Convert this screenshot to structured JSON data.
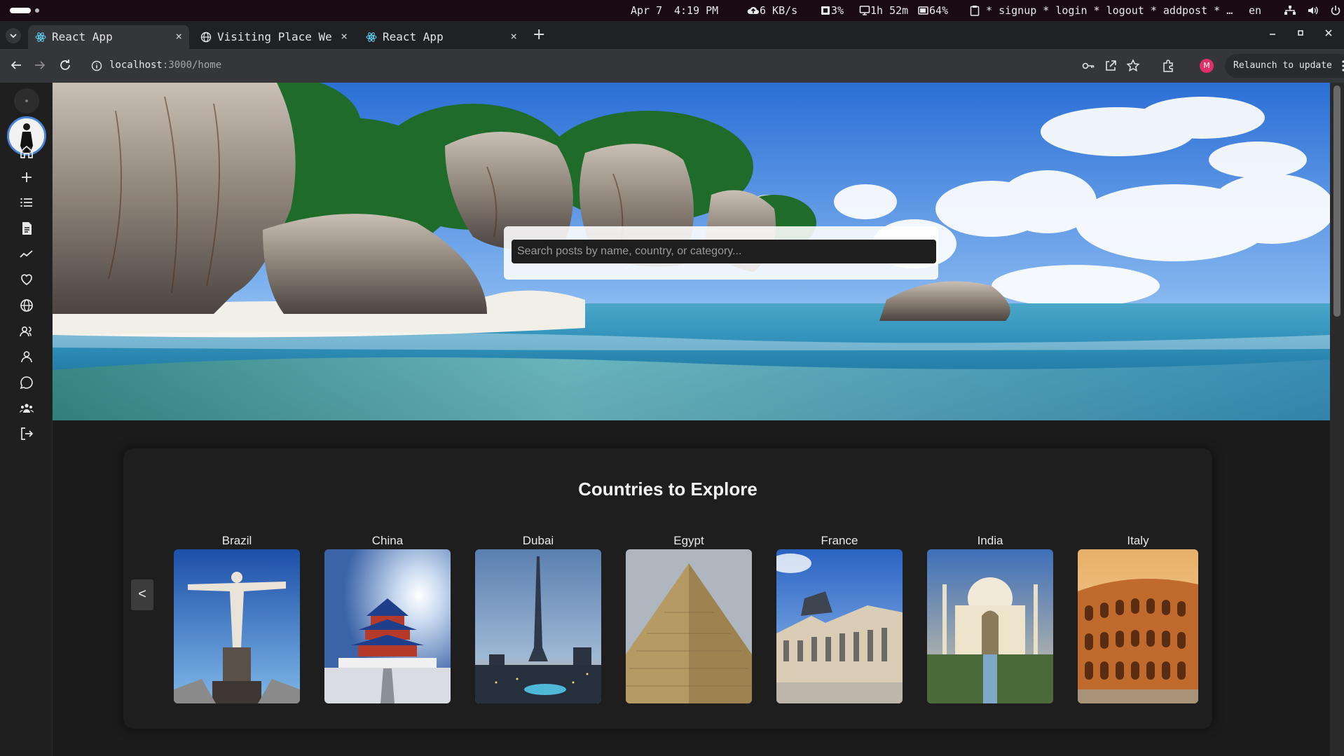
{
  "system_bar": {
    "date": "Apr 7",
    "time": "4:19 PM",
    "network": "6 KB/s",
    "cpu": "3%",
    "uptime": "1h 52m",
    "battery": "64%",
    "clipboard": "* signup * login * logout * addpost * …",
    "lang": "en"
  },
  "tabs": [
    {
      "label": "React App",
      "close": "×"
    },
    {
      "label": "Visiting Place Website",
      "close": "×"
    },
    {
      "label": "React App",
      "close": "×"
    }
  ],
  "new_tab": "+",
  "address": {
    "host": "localhost",
    "path": ":3000/home"
  },
  "relaunch_label": "Relaunch to update",
  "profile_initial": "M",
  "search": {
    "placeholder": "Search posts by name, country, or category..."
  },
  "sidebar_icons": [
    "home-icon",
    "plus-icon",
    "list-icon",
    "document-icon",
    "trending-icon",
    "heart-icon",
    "globe-icon",
    "users-icon",
    "user-icon",
    "chat-icon",
    "group-icon",
    "logout-icon"
  ],
  "explore": {
    "title": "Countries to Explore",
    "prev": "<",
    "next": ">",
    "countries": [
      {
        "name": "Brazil"
      },
      {
        "name": "China"
      },
      {
        "name": "Dubai"
      },
      {
        "name": "Egypt"
      },
      {
        "name": "France"
      },
      {
        "name": "India"
      },
      {
        "name": "Italy"
      }
    ]
  }
}
